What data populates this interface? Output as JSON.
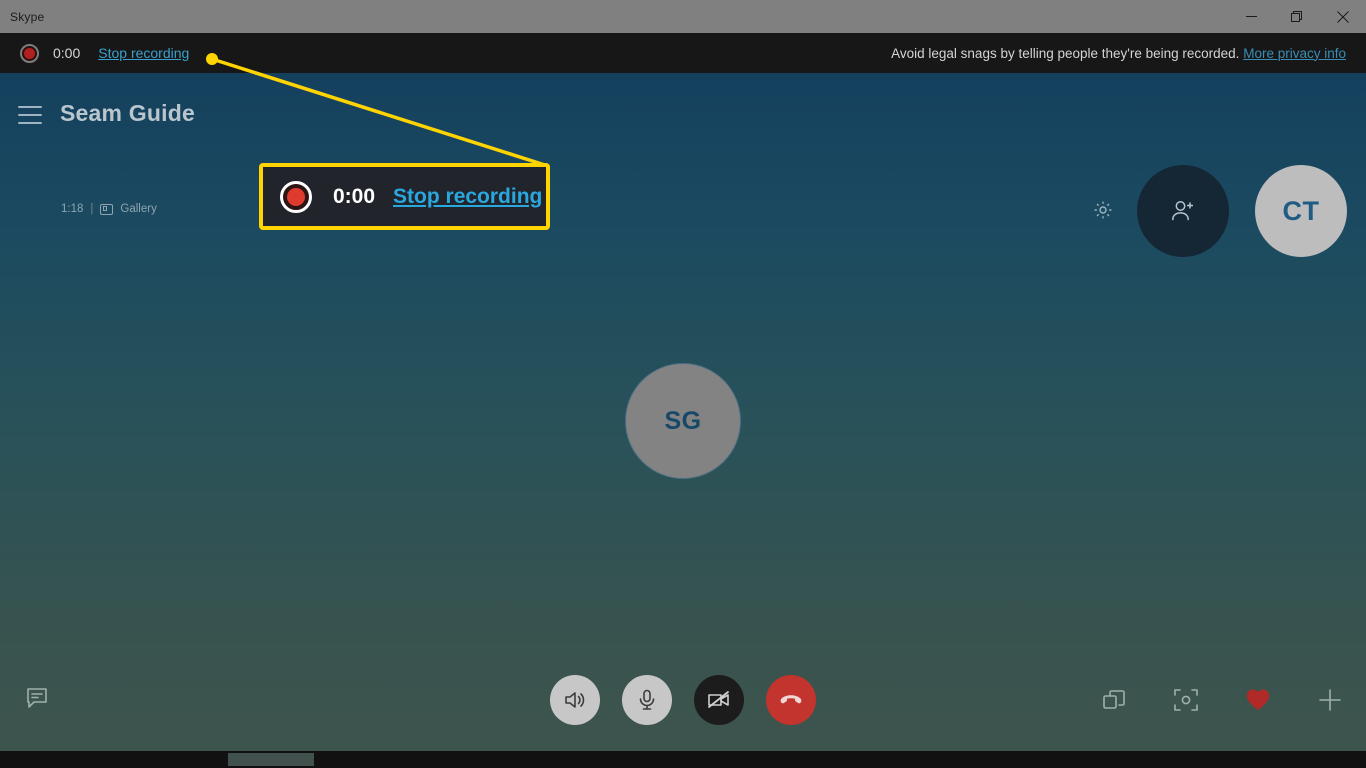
{
  "window": {
    "title": "Skype",
    "controls": [
      {
        "name": "minimize",
        "glyph": "minimize-icon"
      },
      {
        "name": "maximize",
        "glyph": "maximize-icon"
      },
      {
        "name": "close",
        "glyph": "close-icon"
      }
    ]
  },
  "recording_bar": {
    "record_icon": "record-dot-icon",
    "timer": "0:00",
    "stop_label": "Stop recording",
    "notice": "Avoid legal snags by telling people they're being recorded.",
    "privacy_link": "More privacy info"
  },
  "call_header": {
    "menu_icon": "hamburger-icon",
    "title": "Seam Guide",
    "duration": "1:18",
    "separator": "|",
    "view_icon": "gallery-icon",
    "view_label": "Gallery",
    "settings_icon": "gear-icon",
    "add_person_icon": "add-person-icon",
    "account_initials": "CT"
  },
  "participant": {
    "initials": "SG"
  },
  "controls": {
    "chat_icon": "chat-bubble-icon",
    "speaker_icon": "speaker-icon",
    "microphone_icon": "microphone-icon",
    "camera_off_icon": "camera-off-icon",
    "end_call_icon": "end-call-icon",
    "split_view_icon": "split-view-icon",
    "snapshot_icon": "snapshot-icon",
    "reaction_icon": "heart-icon",
    "more_icon": "plus-icon"
  },
  "callout": {
    "record_icon": "record-dot-icon",
    "timer": "0:00",
    "stop_label": "Stop recording"
  },
  "colors": {
    "highlight": "#ffd400",
    "link": "#29a8e0",
    "record_red": "#e03a2f",
    "end_call_red": "#c4342e",
    "heart_red": "#b02b28",
    "titlebar": "#808080",
    "recording_bar": "#171717",
    "stage_top": "#14405e",
    "stage_bottom": "#3d544d"
  }
}
